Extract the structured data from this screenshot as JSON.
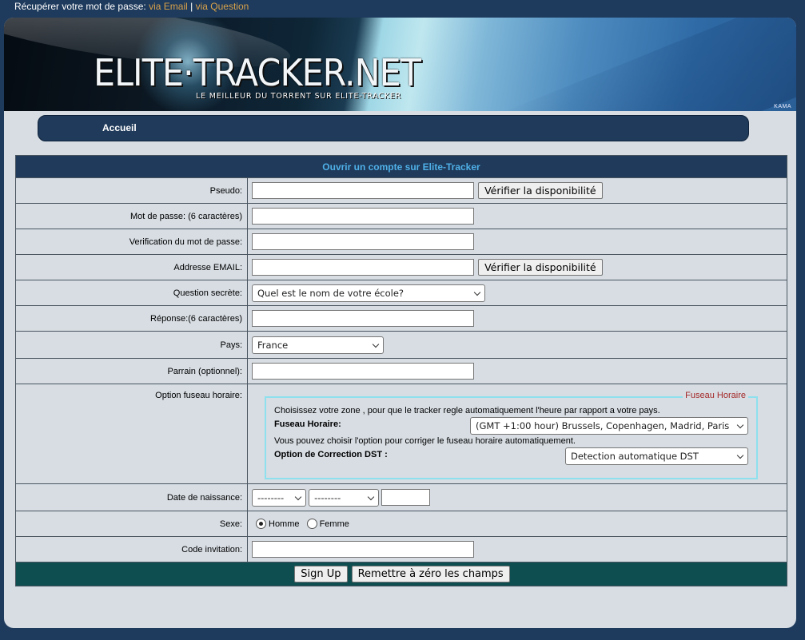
{
  "topbar": {
    "label": "Récupérer votre mot de passe:",
    "via_email": "via Email",
    "sep": "|",
    "via_question": "via Question"
  },
  "banner": {
    "logo": "ELITE·TRACKER.NET",
    "tagline": "LE MEILLEUR DU TORRENT SUR ELITE-TRACKER",
    "credit": "KAMA"
  },
  "nav": {
    "home": "Accueil"
  },
  "form": {
    "title": "Ouvrir un compte sur Elite-Tracker",
    "pseudo_label": "Pseudo:",
    "check_label": "Vérifier la disponibilité",
    "password_label": "Mot de passe: (6 caractères)",
    "password_confirm_label": "Verification du mot de passe:",
    "email_label": "Addresse EMAIL:",
    "question_label": "Question secrète:",
    "question_value": "Quel est le nom de votre école?",
    "answer_label": "Réponse:(6 caractères)",
    "country_label": "Pays:",
    "country_value": "France",
    "sponsor_label": "Parrain (optionnel):",
    "tz_label": "Option fuseau horaire:",
    "tz_box": {
      "legend": "Fuseau Horaire",
      "intro": "Choisissez votre zone , pour que le tracker regle automatiquement l'heure par rapport a votre pays.",
      "tz_field_label": "Fuseau Horaire:",
      "tz_value": "(GMT +1:00 hour) Brussels, Copenhagen, Madrid, Paris",
      "dst_note": "Vous pouvez choisir l'option pour corriger le fuseau horaire automatiquement.",
      "dst_label": "Option de Correction DST :",
      "dst_value": "Detection automatique DST"
    },
    "birth_label": "Date de naissance:",
    "day_value": "--------",
    "month_value": "--------",
    "sex_label": "Sexe:",
    "sex_male": "Homme",
    "sex_female": "Femme",
    "invite_label": "Code invitation:",
    "signup_button": "Sign Up",
    "reset_button": "Remettre à zéro les champs"
  }
}
